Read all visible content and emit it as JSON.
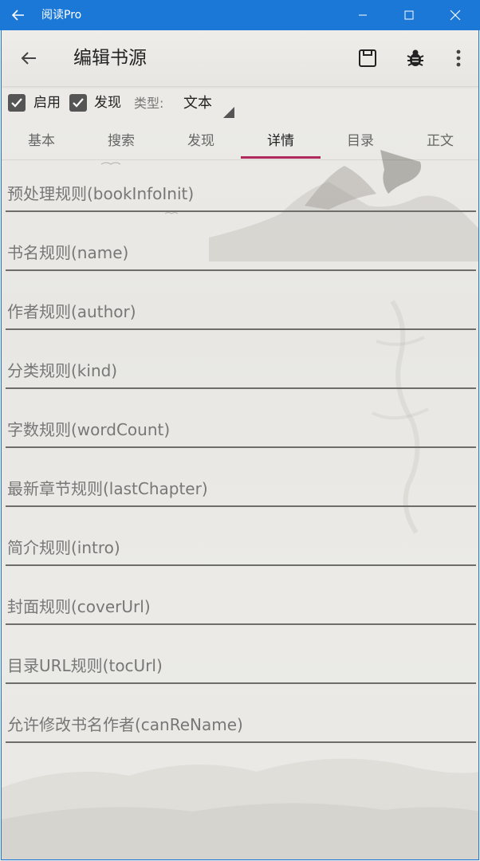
{
  "window": {
    "title": "阅读Pro",
    "icons": {
      "back": "arrow-left-icon",
      "minimize": "minimize-icon",
      "maximize": "maximize-icon",
      "close": "close-icon"
    }
  },
  "toolbar": {
    "title": "编辑书源",
    "icons": {
      "back": "arrow-left-icon",
      "save": "save-icon",
      "debug": "bug-icon",
      "more": "more-vert-icon"
    }
  },
  "options": {
    "enable_label": "启用",
    "enable_checked": true,
    "discover_label": "发现",
    "discover_checked": true,
    "type_label": "类型:",
    "type_value": "文本"
  },
  "tabs": [
    {
      "label": "基本",
      "active": false
    },
    {
      "label": "搜索",
      "active": false
    },
    {
      "label": "发现",
      "active": false
    },
    {
      "label": "详情",
      "active": true
    },
    {
      "label": "目录",
      "active": false
    },
    {
      "label": "正文",
      "active": false
    }
  ],
  "accent_color": "#b0285c",
  "titlebar_color": "#1b78d6",
  "fields": [
    {
      "placeholder": "预处理规则(bookInfoInit)",
      "value": ""
    },
    {
      "placeholder": "书名规则(name)",
      "value": ""
    },
    {
      "placeholder": "作者规则(author)",
      "value": ""
    },
    {
      "placeholder": "分类规则(kind)",
      "value": ""
    },
    {
      "placeholder": "字数规则(wordCount)",
      "value": ""
    },
    {
      "placeholder": "最新章节规则(lastChapter)",
      "value": ""
    },
    {
      "placeholder": "简介规则(intro)",
      "value": ""
    },
    {
      "placeholder": "封面规则(coverUrl)",
      "value": ""
    },
    {
      "placeholder": "目录URL规则(tocUrl)",
      "value": ""
    },
    {
      "placeholder": "允许修改书名作者(canReName)",
      "value": ""
    }
  ]
}
